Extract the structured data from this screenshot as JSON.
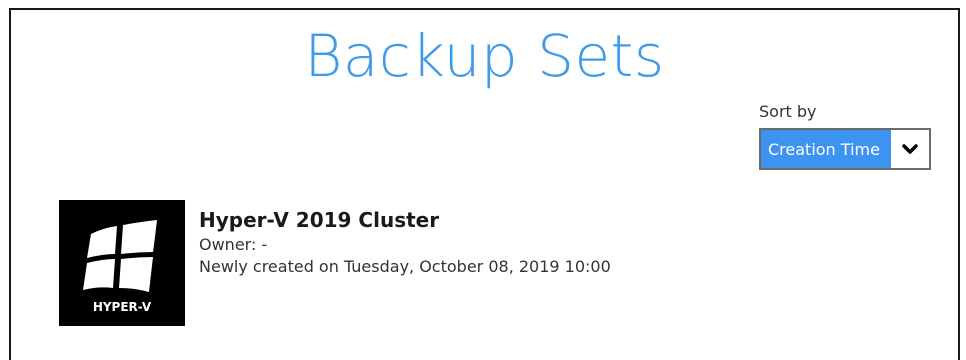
{
  "page": {
    "title": "Backup Sets"
  },
  "sort": {
    "label": "Sort by",
    "selected": "Creation Time"
  },
  "backup_sets": [
    {
      "icon": "hyper-v-windows-logo",
      "tile_label": "HYPER-V",
      "name": "Hyper-V 2019 Cluster",
      "owner": "Owner: -",
      "created": "Newly created on Tuesday, October 08, 2019 10:00"
    }
  ],
  "colors": {
    "title": "#3d9be9",
    "accent": "#3d94f0",
    "tile_bg": "#000000"
  }
}
